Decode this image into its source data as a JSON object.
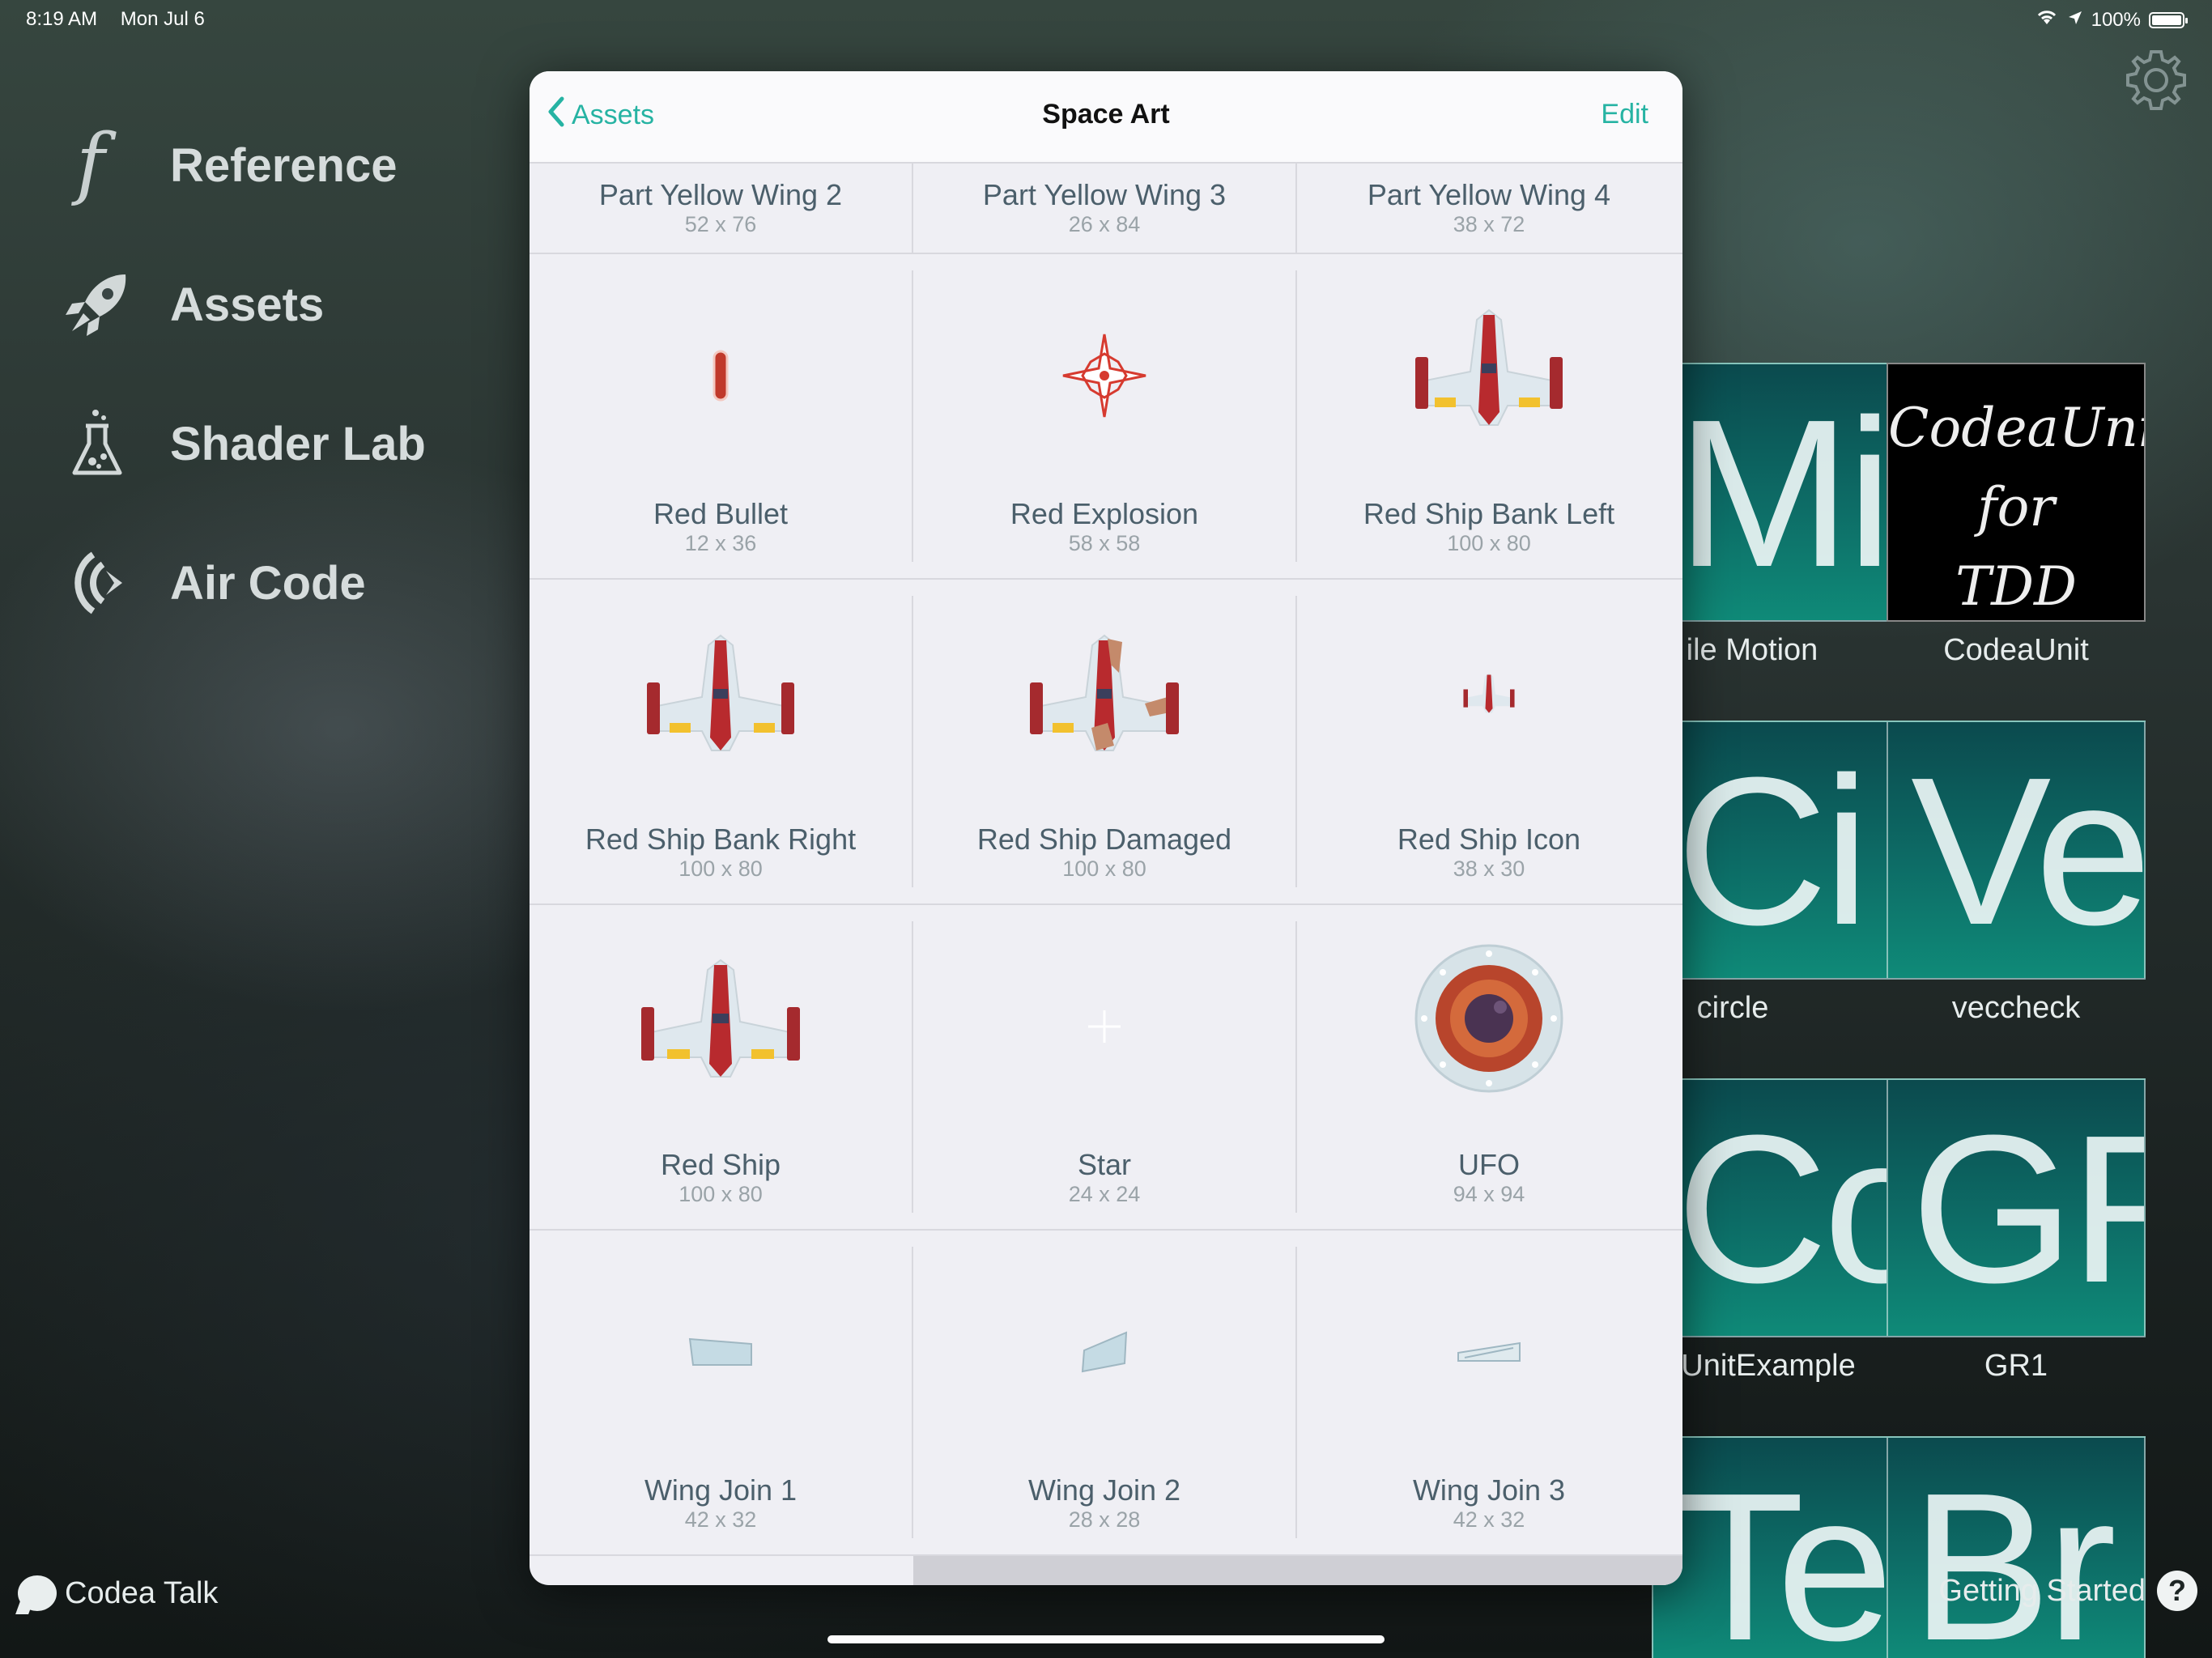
{
  "status_bar": {
    "time": "8:19 AM",
    "date": "Mon Jul 6",
    "battery": "100%"
  },
  "menu": [
    {
      "label": "Reference",
      "icon": "function-icon"
    },
    {
      "label": "Assets",
      "icon": "rocket-icon"
    },
    {
      "label": "Shader Lab",
      "icon": "flask-icon"
    },
    {
      "label": "Air Code",
      "icon": "wireless-icon"
    }
  ],
  "bottom": {
    "talk": "Codea Talk",
    "getting_started": "Getting Started",
    "help_glyph": "?"
  },
  "projects": [
    {
      "label": "ile Motion",
      "letters": "Mi"
    },
    {
      "label": "CodeaUnit",
      "tile_title_lines": [
        "CodeaUnit",
        "for",
        "TDD"
      ]
    },
    {
      "label": "circle",
      "letters": "Ci"
    },
    {
      "label": "veccheck",
      "letters": "Ve"
    },
    {
      "label": "UnitExample",
      "letters": "Co"
    },
    {
      "label": "GR1",
      "letters": "GR"
    },
    {
      "label": "",
      "letters": "Te"
    },
    {
      "label": "",
      "letters": "Br"
    }
  ],
  "popover": {
    "back_label": "Assets",
    "title": "Space Art",
    "edit_label": "Edit",
    "partial_row": [
      {
        "name": "Part Yellow Wing 2",
        "size": "52 x 76"
      },
      {
        "name": "Part Yellow Wing 3",
        "size": "26 x 84"
      },
      {
        "name": "Part Yellow Wing 4",
        "size": "38 x 72"
      }
    ],
    "rows": [
      [
        {
          "name": "Red Bullet",
          "size": "12 x 36",
          "art": "bullet"
        },
        {
          "name": "Red Explosion",
          "size": "58 x 58",
          "art": "explosion"
        },
        {
          "name": "Red Ship Bank Left",
          "size": "100 x 80",
          "art": "ship-left"
        }
      ],
      [
        {
          "name": "Red Ship Bank Right",
          "size": "100 x 80",
          "art": "ship-right"
        },
        {
          "name": "Red Ship Damaged",
          "size": "100 x 80",
          "art": "ship-damaged"
        },
        {
          "name": "Red Ship Icon",
          "size": "38 x 30",
          "art": "ship-icon"
        }
      ],
      [
        {
          "name": "Red Ship",
          "size": "100 x 80",
          "art": "ship"
        },
        {
          "name": "Star",
          "size": "24 x 24",
          "art": "star"
        },
        {
          "name": "UFO",
          "size": "94 x 94",
          "art": "ufo"
        }
      ],
      [
        {
          "name": "Wing Join 1",
          "size": "42 x 32",
          "art": "wing1"
        },
        {
          "name": "Wing Join 2",
          "size": "28 x 28",
          "art": "wing2"
        },
        {
          "name": "Wing Join 3",
          "size": "42 x 32",
          "art": "wing3"
        }
      ]
    ]
  }
}
